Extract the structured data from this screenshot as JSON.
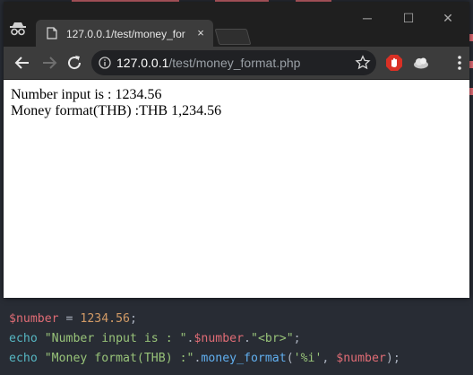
{
  "browser": {
    "tab_title": "127.0.0.1/test/money_for",
    "tab_close": "×",
    "url_host": "127.0.0.1",
    "url_path": "/test/money_format.php",
    "window_controls": {
      "minimize": "─",
      "maximize": "☐",
      "close": "✕"
    }
  },
  "page": {
    "line1": "Number input is : 1234.56",
    "line2": "Money format(THB) :THB 1,234.56"
  },
  "code": {
    "line1": {
      "var": "$number",
      "op": " = ",
      "num": "1234.56",
      "end": ";"
    },
    "line2": {
      "kw": "echo",
      "sp": " ",
      "s1": "\"Number input is : \"",
      "dot1": ".",
      "var": "$number",
      "dot2": ".",
      "s2": "\"<br>\"",
      "end": ";"
    },
    "line3": {
      "kw": "echo",
      "sp": " ",
      "s1": "\"Money format(THB) :\"",
      "dot": ".",
      "fn": "money_format",
      "open": "(",
      "arg": "'%i'",
      "comma": ", ",
      "var": "$number",
      "close": ");"
    }
  },
  "colors": {
    "variable": "#e06c75",
    "keyword": "#56b6c2",
    "string": "#98c379",
    "number": "#d19a66",
    "function": "#61afef",
    "editor_bg": "#282c34"
  }
}
